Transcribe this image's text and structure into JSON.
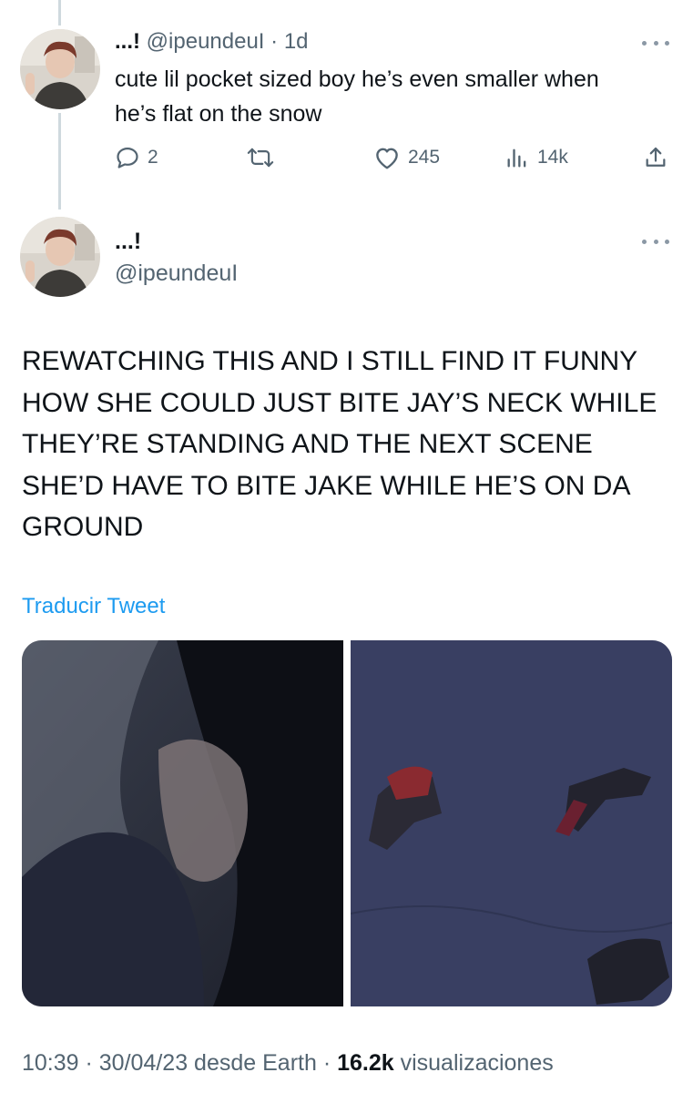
{
  "reply": {
    "display_name": "...!",
    "handle": "@ipeundeuI",
    "separator": "·",
    "time_ago": "1d",
    "text": "cute lil pocket sized boy he’s even smaller when he’s flat on the snow",
    "actions": {
      "replies": "2",
      "retweets": "",
      "likes": "245",
      "views": "14k"
    }
  },
  "tweet": {
    "display_name": "...!",
    "handle": "@ipeundeuI",
    "text": "REWATCHING THIS AND I STILL FIND IT FUNNY HOW SHE COULD JUST BITE JAY’S NECK WHILE THEY’RE STANDING AND THE NEXT SCENE SHE’D HAVE TO BITE JAKE WHILE HE’S ON DA GROUND",
    "translate_label": "Traducir Tweet",
    "media": [
      {
        "description": "close-up dark scene"
      },
      {
        "description": "people lying in the snow"
      }
    ],
    "footer": {
      "time": "10:39",
      "dot1": " · ",
      "date": "30/04/23",
      "source": " desde Earth",
      "dot2": " · ",
      "views_count": "16.2k",
      "views_label": " visualizaciones"
    }
  },
  "colors": {
    "link": "#1d9bf0",
    "secondary": "#536471",
    "thread_line": "#cfd9de"
  },
  "icons": [
    "reply-icon",
    "retweet-icon",
    "like-icon",
    "views-icon",
    "share-icon",
    "more-icon"
  ]
}
